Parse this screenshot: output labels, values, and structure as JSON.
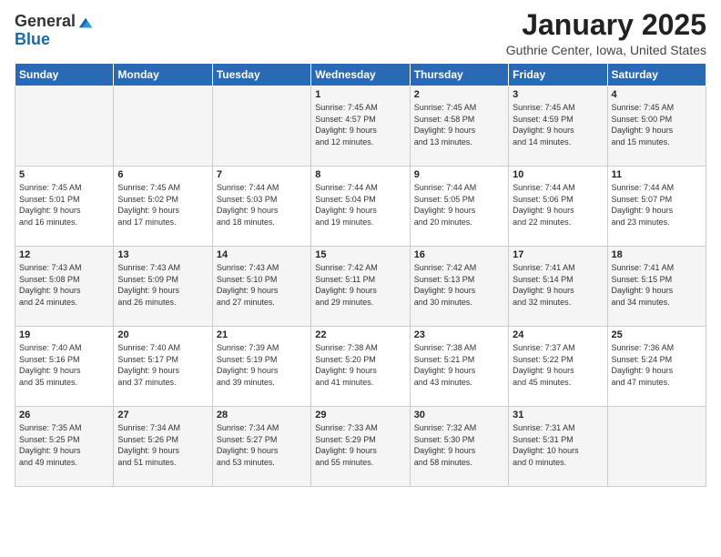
{
  "logo": {
    "general": "General",
    "blue": "Blue"
  },
  "header": {
    "title": "January 2025",
    "location": "Guthrie Center, Iowa, United States"
  },
  "days": [
    "Sunday",
    "Monday",
    "Tuesday",
    "Wednesday",
    "Thursday",
    "Friday",
    "Saturday"
  ],
  "weeks": [
    [
      {
        "day": "",
        "info": ""
      },
      {
        "day": "",
        "info": ""
      },
      {
        "day": "",
        "info": ""
      },
      {
        "day": "1",
        "info": "Sunrise: 7:45 AM\nSunset: 4:57 PM\nDaylight: 9 hours\nand 12 minutes."
      },
      {
        "day": "2",
        "info": "Sunrise: 7:45 AM\nSunset: 4:58 PM\nDaylight: 9 hours\nand 13 minutes."
      },
      {
        "day": "3",
        "info": "Sunrise: 7:45 AM\nSunset: 4:59 PM\nDaylight: 9 hours\nand 14 minutes."
      },
      {
        "day": "4",
        "info": "Sunrise: 7:45 AM\nSunset: 5:00 PM\nDaylight: 9 hours\nand 15 minutes."
      }
    ],
    [
      {
        "day": "5",
        "info": "Sunrise: 7:45 AM\nSunset: 5:01 PM\nDaylight: 9 hours\nand 16 minutes."
      },
      {
        "day": "6",
        "info": "Sunrise: 7:45 AM\nSunset: 5:02 PM\nDaylight: 9 hours\nand 17 minutes."
      },
      {
        "day": "7",
        "info": "Sunrise: 7:44 AM\nSunset: 5:03 PM\nDaylight: 9 hours\nand 18 minutes."
      },
      {
        "day": "8",
        "info": "Sunrise: 7:44 AM\nSunset: 5:04 PM\nDaylight: 9 hours\nand 19 minutes."
      },
      {
        "day": "9",
        "info": "Sunrise: 7:44 AM\nSunset: 5:05 PM\nDaylight: 9 hours\nand 20 minutes."
      },
      {
        "day": "10",
        "info": "Sunrise: 7:44 AM\nSunset: 5:06 PM\nDaylight: 9 hours\nand 22 minutes."
      },
      {
        "day": "11",
        "info": "Sunrise: 7:44 AM\nSunset: 5:07 PM\nDaylight: 9 hours\nand 23 minutes."
      }
    ],
    [
      {
        "day": "12",
        "info": "Sunrise: 7:43 AM\nSunset: 5:08 PM\nDaylight: 9 hours\nand 24 minutes."
      },
      {
        "day": "13",
        "info": "Sunrise: 7:43 AM\nSunset: 5:09 PM\nDaylight: 9 hours\nand 26 minutes."
      },
      {
        "day": "14",
        "info": "Sunrise: 7:43 AM\nSunset: 5:10 PM\nDaylight: 9 hours\nand 27 minutes."
      },
      {
        "day": "15",
        "info": "Sunrise: 7:42 AM\nSunset: 5:11 PM\nDaylight: 9 hours\nand 29 minutes."
      },
      {
        "day": "16",
        "info": "Sunrise: 7:42 AM\nSunset: 5:13 PM\nDaylight: 9 hours\nand 30 minutes."
      },
      {
        "day": "17",
        "info": "Sunrise: 7:41 AM\nSunset: 5:14 PM\nDaylight: 9 hours\nand 32 minutes."
      },
      {
        "day": "18",
        "info": "Sunrise: 7:41 AM\nSunset: 5:15 PM\nDaylight: 9 hours\nand 34 minutes."
      }
    ],
    [
      {
        "day": "19",
        "info": "Sunrise: 7:40 AM\nSunset: 5:16 PM\nDaylight: 9 hours\nand 35 minutes."
      },
      {
        "day": "20",
        "info": "Sunrise: 7:40 AM\nSunset: 5:17 PM\nDaylight: 9 hours\nand 37 minutes."
      },
      {
        "day": "21",
        "info": "Sunrise: 7:39 AM\nSunset: 5:19 PM\nDaylight: 9 hours\nand 39 minutes."
      },
      {
        "day": "22",
        "info": "Sunrise: 7:38 AM\nSunset: 5:20 PM\nDaylight: 9 hours\nand 41 minutes."
      },
      {
        "day": "23",
        "info": "Sunrise: 7:38 AM\nSunset: 5:21 PM\nDaylight: 9 hours\nand 43 minutes."
      },
      {
        "day": "24",
        "info": "Sunrise: 7:37 AM\nSunset: 5:22 PM\nDaylight: 9 hours\nand 45 minutes."
      },
      {
        "day": "25",
        "info": "Sunrise: 7:36 AM\nSunset: 5:24 PM\nDaylight: 9 hours\nand 47 minutes."
      }
    ],
    [
      {
        "day": "26",
        "info": "Sunrise: 7:35 AM\nSunset: 5:25 PM\nDaylight: 9 hours\nand 49 minutes."
      },
      {
        "day": "27",
        "info": "Sunrise: 7:34 AM\nSunset: 5:26 PM\nDaylight: 9 hours\nand 51 minutes."
      },
      {
        "day": "28",
        "info": "Sunrise: 7:34 AM\nSunset: 5:27 PM\nDaylight: 9 hours\nand 53 minutes."
      },
      {
        "day": "29",
        "info": "Sunrise: 7:33 AM\nSunset: 5:29 PM\nDaylight: 9 hours\nand 55 minutes."
      },
      {
        "day": "30",
        "info": "Sunrise: 7:32 AM\nSunset: 5:30 PM\nDaylight: 9 hours\nand 58 minutes."
      },
      {
        "day": "31",
        "info": "Sunrise: 7:31 AM\nSunset: 5:31 PM\nDaylight: 10 hours\nand 0 minutes."
      },
      {
        "day": "",
        "info": ""
      }
    ]
  ]
}
